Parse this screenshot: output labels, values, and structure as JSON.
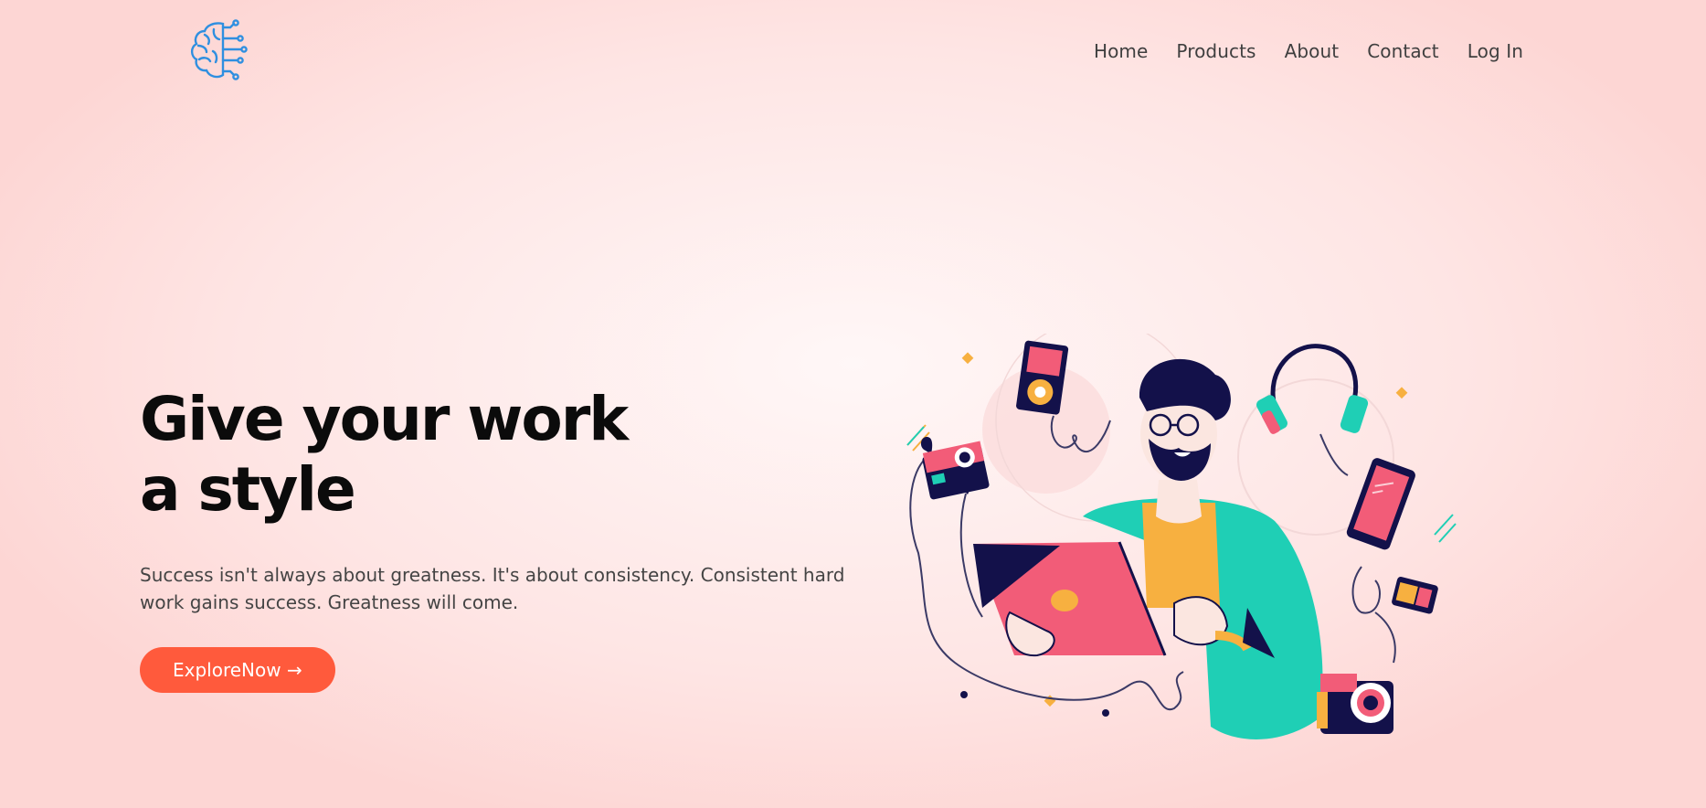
{
  "header": {
    "logo_icon": "brain-circuit-icon",
    "nav": {
      "home": "Home",
      "products": "Products",
      "about": "About",
      "contact": "Contact",
      "login": "Log In"
    }
  },
  "hero": {
    "title_line1": "Give your work",
    "title_line2": "a style",
    "description": "Success isn't always about greatness. It's about consistency. Consistent hard work gains success. Greatness will come.",
    "button_label": "ExploreNow →"
  },
  "illustration": {
    "icon": "man-with-laptop-and-gadgets-illustration",
    "colors": {
      "accent": "#ff5a3c",
      "pink": "#f25c78",
      "teal": "#1fcfb5",
      "orange": "#f7b040",
      "navy": "#13114a",
      "logo_blue": "#2f8fe0"
    }
  }
}
